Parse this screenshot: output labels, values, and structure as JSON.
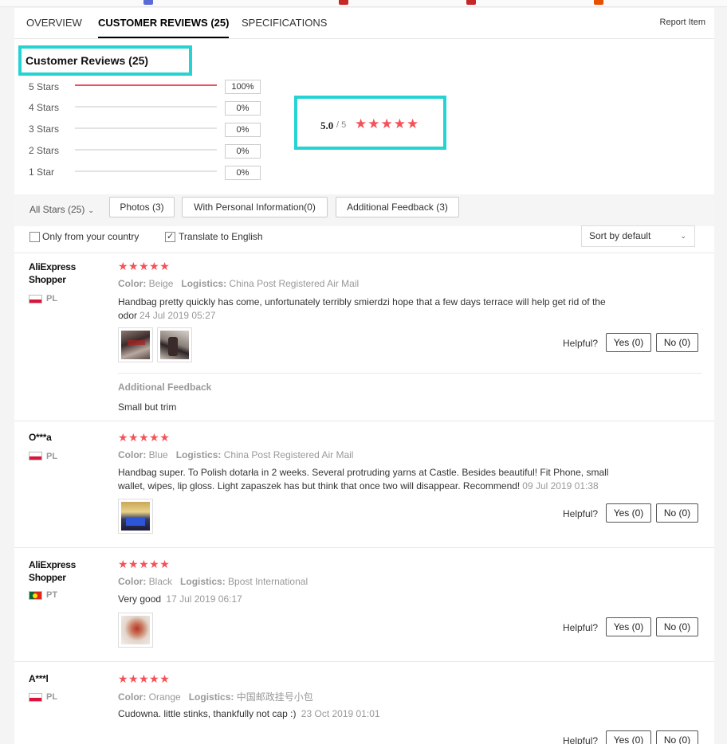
{
  "tabs": [
    {
      "label": "OVERVIEW"
    },
    {
      "label": "CUSTOMER REVIEWS (25)"
    },
    {
      "label": "SPECIFICATIONS"
    }
  ],
  "report_item": "Report Item",
  "reviews_heading": "Customer Reviews (25)",
  "distribution": [
    {
      "label": "5 Stars",
      "percent_text": "100%",
      "fraction": 1.0
    },
    {
      "label": "4 Stars",
      "percent_text": "0%",
      "fraction": 0
    },
    {
      "label": "3 Stars",
      "percent_text": "0%",
      "fraction": 0
    },
    {
      "label": "2 Stars",
      "percent_text": "0%",
      "fraction": 0
    },
    {
      "label": "1 Star",
      "percent_text": "0%",
      "fraction": 0
    }
  ],
  "average": {
    "score": "5.0",
    "max": "/ 5",
    "stars": "★★★★★"
  },
  "filters": {
    "all_stars": "All Stars (25)",
    "photos": "Photos (3)",
    "personal": "With Personal Information(0)",
    "additional": "Additional Feedback (3)",
    "only_country": "Only from your country",
    "translate": "Translate to English",
    "sort": "Sort by default"
  },
  "helpful_label": "Helpful?",
  "reviews": [
    {
      "name": "AliExpress Shopper",
      "country": "PL",
      "stars": "★★★★★",
      "color_label": "Color:",
      "color": "Beige",
      "logistics_label": "Logistics:",
      "logistics": "China Post Registered Air Mail",
      "text": "Handbag pretty quickly has come, unfortunately terribly smierdzi hope that a few days terrace will help get rid of the odor",
      "date": "24 Jul 2019 05:27",
      "yes": "Yes (0)",
      "no": "No (0)",
      "additional_label": "Additional Feedback",
      "additional_text": "Small but trim"
    },
    {
      "name": "O***a",
      "country": "PL",
      "stars": "★★★★★",
      "color_label": "Color:",
      "color": "Blue",
      "logistics_label": "Logistics:",
      "logistics": "China Post Registered Air Mail",
      "text": "Handbag super. To Polish dotarła in 2 weeks. Several protruding yarns at Castle. Besides beautiful! Fit Phone, small wallet, wipes, lip gloss. Light zapaszek has but think that once two will disappear. Recommend!",
      "date": "09 Jul 2019 01:38",
      "yes": "Yes (0)",
      "no": "No (0)"
    },
    {
      "name": "AliExpress Shopper",
      "country": "PT",
      "stars": "★★★★★",
      "color_label": "Color:",
      "color": "Black",
      "logistics_label": "Logistics:",
      "logistics": "Bpost International",
      "text": "Very good",
      "date": "17 Jul 2019 06:17",
      "yes": "Yes (0)",
      "no": "No (0)"
    },
    {
      "name": "A***l",
      "country": "PL",
      "stars": "★★★★★",
      "color_label": "Color:",
      "color": "Orange",
      "logistics_label": "Logistics:",
      "logistics": "中国邮政挂号小包",
      "text": "Cudowna. little stinks, thankfully not cap :)",
      "date": "23 Oct 2019 01:01",
      "yes": "Yes (0)",
      "no": "No (0)"
    }
  ],
  "colors": {
    "star": "#f55157",
    "bar_fill": "#e8535f",
    "highlight": "#26d3d3"
  }
}
